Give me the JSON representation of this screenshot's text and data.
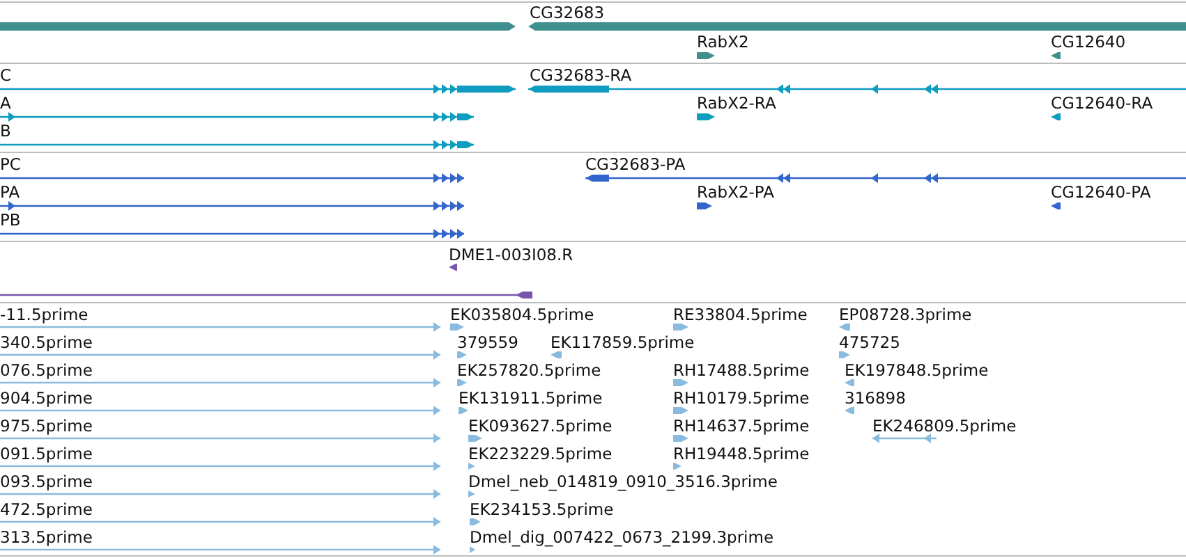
{
  "tracks": [
    {
      "features": [
        {
          "forward": true
        },
        {
          "label": "CG32683",
          "forward": false
        },
        {
          "label": "RabX2",
          "forward": true
        },
        {
          "label": "CG12640",
          "forward": false
        }
      ]
    },
    {
      "features": [
        {
          "label": "C",
          "forward": true
        },
        {
          "label": "CG32683-RA",
          "forward": false
        },
        {
          "label": "A",
          "forward": true
        },
        {
          "label": "RabX2-RA",
          "forward": true
        },
        {
          "label": "CG12640-RA",
          "forward": false
        },
        {
          "label": "B",
          "forward": true
        }
      ]
    },
    {
      "features": [
        {
          "label": "PC",
          "forward": true
        },
        {
          "label": "CG32683-PA",
          "forward": false
        },
        {
          "label": "PA",
          "forward": true
        },
        {
          "label": "RabX2-PA",
          "forward": true
        },
        {
          "label": "CG12640-PA",
          "forward": false
        },
        {
          "label": "PB",
          "forward": true
        }
      ]
    },
    {
      "features": [
        {
          "label": "DME1-003I08.R",
          "forward": false
        },
        {
          "forward": false
        }
      ]
    },
    {
      "features": [
        {
          "label": "-11.5prime",
          "forward": true
        },
        {
          "label": "EK035804.5prime",
          "forward": true
        },
        {
          "label": "RE33804.5prime",
          "forward": true
        },
        {
          "label": "EP08728.3prime",
          "forward": false
        },
        {
          "label": "340.5prime",
          "forward": true
        },
        {
          "label": "379559",
          "forward": true
        },
        {
          "label": "EK117859.5prime",
          "forward": false
        },
        {
          "label": "475725",
          "forward": true
        },
        {
          "label": "076.5prime",
          "forward": true
        },
        {
          "label": "EK257820.5prime",
          "forward": true
        },
        {
          "label": "RH17488.5prime",
          "forward": true
        },
        {
          "label": "EK197848.5prime",
          "forward": false
        },
        {
          "label": "904.5prime",
          "forward": true
        },
        {
          "label": "EK131911.5prime",
          "forward": true
        },
        {
          "label": "RH10179.5prime",
          "forward": true
        },
        {
          "label": "316898",
          "forward": false
        },
        {
          "label": "975.5prime",
          "forward": true
        },
        {
          "label": "EK093627.5prime",
          "forward": true
        },
        {
          "label": "RH14637.5prime",
          "forward": true
        },
        {
          "label": "EK246809.5prime",
          "forward": false
        },
        {
          "label": "091.5prime",
          "forward": true
        },
        {
          "label": "EK223229.5prime",
          "forward": true
        },
        {
          "label": "RH19448.5prime",
          "forward": true
        },
        {
          "label": "093.5prime",
          "forward": true
        },
        {
          "label": "Dmel_neb_014819_0910_3516.3prime",
          "forward": true
        },
        {
          "label": "472.5prime",
          "forward": true
        },
        {
          "label": "EK234153.5prime",
          "forward": true
        },
        {
          "label": "313.5prime",
          "forward": true
        },
        {
          "label": "Dmel_dig_007422_0673_2199.3prime",
          "forward": true
        }
      ]
    }
  ]
}
